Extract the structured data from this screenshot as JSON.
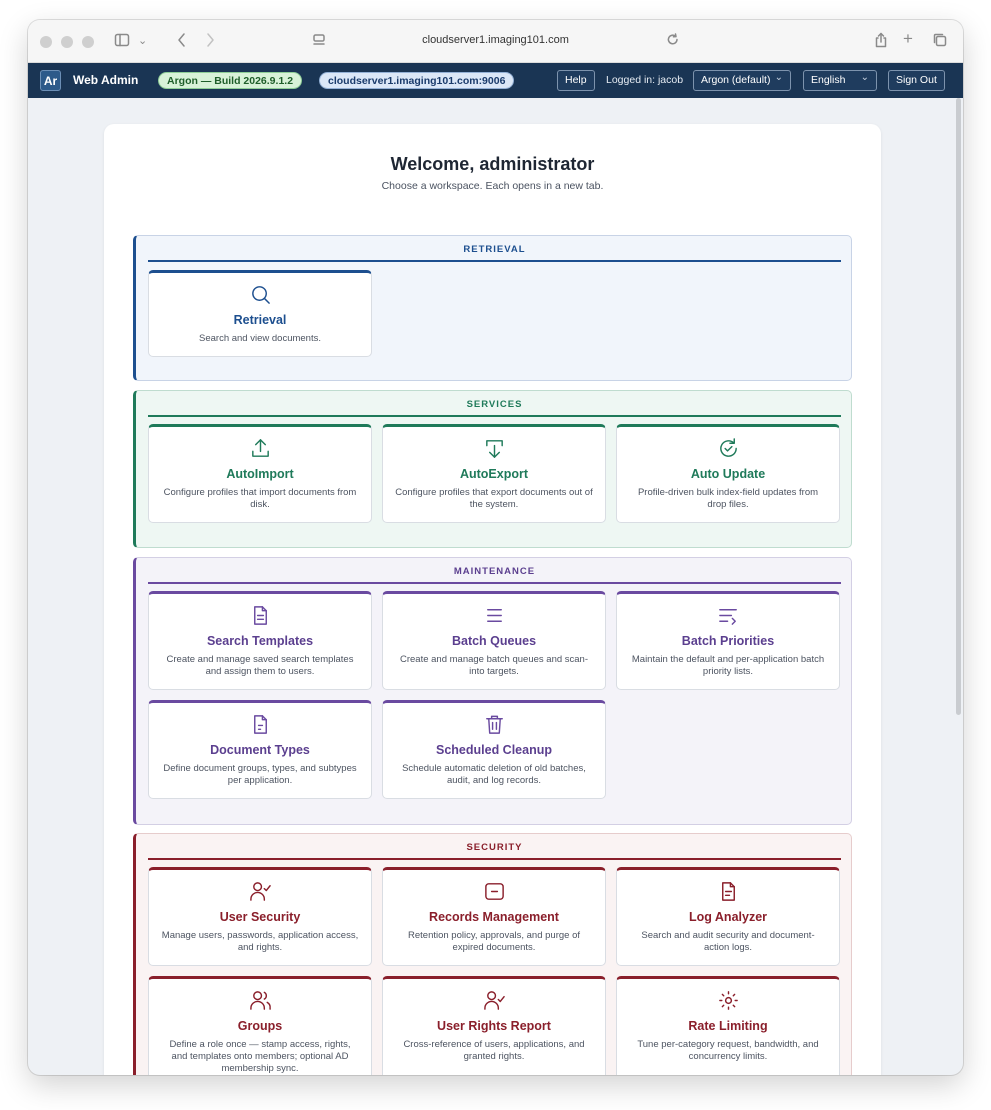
{
  "browser": {
    "url": "cloudserver1.imaging101.com"
  },
  "header": {
    "logo": "Ar",
    "brand": "Web Admin",
    "build": "Argon — Build 2026.9.1.2",
    "server": "cloudserver1.imaging101.com:9006",
    "help": "Help",
    "logged_in": "Logged in: jacob",
    "theme": "Argon (default)",
    "language": "English",
    "sign_out": "Sign Out"
  },
  "welcome": {
    "title": "Welcome, administrator",
    "subtitle": "Choose a workspace. Each opens in a new tab."
  },
  "sections": {
    "retrieval": {
      "title": "RETRIEVAL",
      "tiles": [
        {
          "icon": "search-icon",
          "title": "Retrieval",
          "desc": "Search and view documents."
        }
      ]
    },
    "services": {
      "title": "SERVICES",
      "tiles": [
        {
          "icon": "upload-icon",
          "title": "AutoImport",
          "desc": "Configure profiles that import documents from disk."
        },
        {
          "icon": "export-icon",
          "title": "AutoExport",
          "desc": "Configure profiles that export documents out of the system."
        },
        {
          "icon": "refresh-check-icon",
          "title": "Auto Update",
          "desc": "Profile-driven bulk index-field updates from drop files."
        }
      ]
    },
    "maintenance": {
      "title": "MAINTENANCE",
      "tiles": [
        {
          "icon": "document-icon",
          "title": "Search Templates",
          "desc": "Create and manage saved search templates and assign them to users."
        },
        {
          "icon": "list-icon",
          "title": "Batch Queues",
          "desc": "Create and manage batch queues and scan-into targets."
        },
        {
          "icon": "priority-list-icon",
          "title": "Batch Priorities",
          "desc": "Maintain the default and per-application batch priority lists."
        },
        {
          "icon": "document-type-icon",
          "title": "Document Types",
          "desc": "Define document groups, types, and subtypes per application."
        },
        {
          "icon": "trash-icon",
          "title": "Scheduled Cleanup",
          "desc": "Schedule automatic deletion of old batches, audit, and log records."
        }
      ]
    },
    "security": {
      "title": "SECURITY",
      "tiles": [
        {
          "icon": "user-check-icon",
          "title": "User Security",
          "desc": "Manage users, passwords, application access, and rights."
        },
        {
          "icon": "archive-box-icon",
          "title": "Records Management",
          "desc": "Retention policy, approvals, and purge of expired documents."
        },
        {
          "icon": "log-file-icon",
          "title": "Log Analyzer",
          "desc": "Search and audit security and document-action logs."
        },
        {
          "icon": "users-icon",
          "title": "Groups",
          "desc": "Define a role once — stamp access, rights, and templates onto members; optional AD membership sync."
        },
        {
          "icon": "user-report-icon",
          "title": "User Rights Report",
          "desc": "Cross-reference of users, applications, and granted rights."
        },
        {
          "icon": "rate-limit-icon",
          "title": "Rate Limiting",
          "desc": "Tune per-category request, bandwidth, and concurrency limits."
        }
      ]
    }
  }
}
